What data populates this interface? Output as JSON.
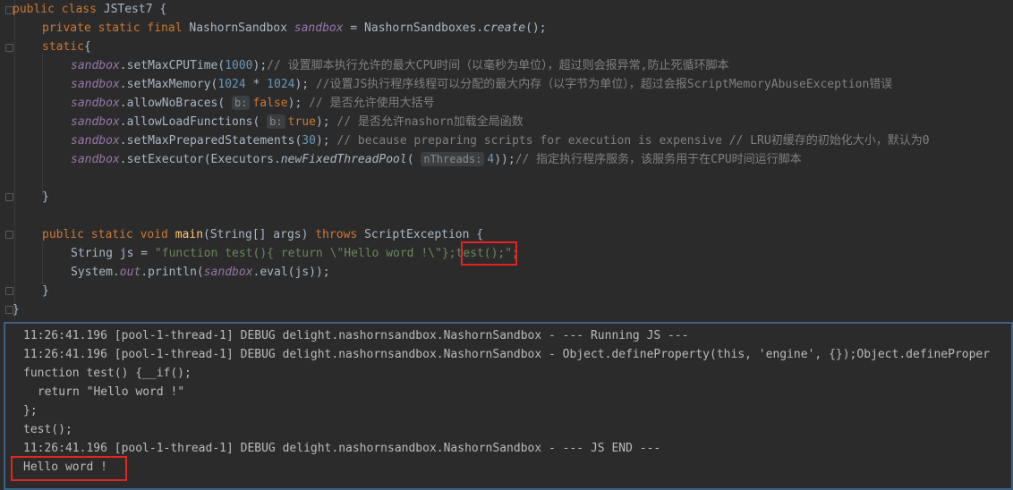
{
  "editor": {
    "lines": [
      [
        {
          "t": "public class ",
          "c": "kw"
        },
        {
          "t": "JSTest7 {",
          "c": ""
        }
      ],
      [
        {
          "t": "private static final ",
          "c": "kw"
        },
        {
          "t": "NashornSandbox ",
          "c": ""
        },
        {
          "t": "sandbox",
          "c": "fld"
        },
        {
          "t": " = NashornSandboxes.",
          "c": ""
        },
        {
          "t": "create",
          "c": "st"
        },
        {
          "t": "();",
          "c": ""
        }
      ],
      [
        {
          "t": "static",
          "c": "kw"
        },
        {
          "t": "{",
          "c": ""
        }
      ],
      [
        {
          "t": "sandbox",
          "c": "fld"
        },
        {
          "t": ".setMaxCPUTime(",
          "c": ""
        },
        {
          "t": "1000",
          "c": "num"
        },
        {
          "t": ");",
          "c": ""
        },
        {
          "t": "// 设置脚本执行允许的最大CPU时间（以毫秒为单位），超过则会报异常,防止死循环脚本",
          "c": "cmt"
        }
      ],
      [
        {
          "t": "sandbox",
          "c": "fld"
        },
        {
          "t": ".setMaxMemory(",
          "c": ""
        },
        {
          "t": "1024",
          "c": "num"
        },
        {
          "t": " * ",
          "c": ""
        },
        {
          "t": "1024",
          "c": "num"
        },
        {
          "t": "); ",
          "c": ""
        },
        {
          "t": "//设置JS执行程序线程可以分配的最大内存（以字节为单位），超过会报ScriptMemoryAbuseException错误",
          "c": "cmt"
        }
      ],
      [
        {
          "t": "sandbox",
          "c": "fld"
        },
        {
          "t": ".allowNoBraces( ",
          "c": ""
        },
        {
          "t": "b:",
          "c": "hint"
        },
        {
          "t": "false",
          "c": "kw"
        },
        {
          "t": "); ",
          "c": ""
        },
        {
          "t": "// 是否允许使用大括号",
          "c": "cmt"
        }
      ],
      [
        {
          "t": "sandbox",
          "c": "fld"
        },
        {
          "t": ".allowLoadFunctions( ",
          "c": ""
        },
        {
          "t": "b:",
          "c": "hint"
        },
        {
          "t": "true",
          "c": "kw"
        },
        {
          "t": "); ",
          "c": ""
        },
        {
          "t": "// 是否允许nashorn加载全局函数",
          "c": "cmt"
        }
      ],
      [
        {
          "t": "sandbox",
          "c": "fld"
        },
        {
          "t": ".setMaxPreparedStatements(",
          "c": ""
        },
        {
          "t": "30",
          "c": "num"
        },
        {
          "t": "); ",
          "c": ""
        },
        {
          "t": "// because preparing scripts for execution is expensive // LRU初缓存的初始化大小，默认为0",
          "c": "cmt"
        }
      ],
      [
        {
          "t": "sandbox",
          "c": "fld"
        },
        {
          "t": ".setExecutor(Executors.",
          "c": ""
        },
        {
          "t": "newFixedThreadPool",
          "c": "st"
        },
        {
          "t": "( ",
          "c": ""
        },
        {
          "t": "nThreads:",
          "c": "hint"
        },
        {
          "t": "4",
          "c": "num"
        },
        {
          "t": "));",
          "c": ""
        },
        {
          "t": "// 指定执行程序服务，该服务用于在CPU时间运行脚本",
          "c": "cmt"
        }
      ],
      [],
      [
        {
          "t": "}",
          "c": ""
        }
      ],
      [],
      [
        {
          "t": "public static void ",
          "c": "kw"
        },
        {
          "t": "main",
          "c": "fn"
        },
        {
          "t": "(String[] args) ",
          "c": ""
        },
        {
          "t": "throws ",
          "c": "kw"
        },
        {
          "t": "ScriptException {",
          "c": ""
        }
      ],
      [
        {
          "t": "String js = ",
          "c": ""
        },
        {
          "t": "\"function test(){ return \\\"Hello word !\\\"};test();\"",
          "c": "str"
        },
        {
          "t": ";",
          "c": "kw"
        }
      ],
      [
        {
          "t": "System.",
          "c": ""
        },
        {
          "t": "out",
          "c": "fld"
        },
        {
          "t": ".println(",
          "c": ""
        },
        {
          "t": "sandbox",
          "c": "fld"
        },
        {
          "t": ".eval(js));",
          "c": ""
        }
      ],
      [
        {
          "t": "}",
          "c": ""
        }
      ],
      [
        {
          "t": "}",
          "c": ""
        }
      ]
    ]
  },
  "console": {
    "lines": [
      "11:26:41.196 [pool-1-thread-1] DEBUG delight.nashornsandbox.NashornSandbox - --- Running JS ---",
      "11:26:41.196 [pool-1-thread-1] DEBUG delight.nashornsandbox.NashornSandbox - Object.defineProperty(this, 'engine', {});Object.defineProper",
      "function test() {__if();",
      " return \"Hello word !\"",
      "};",
      "test();",
      "11:26:41.196 [pool-1-thread-1] DEBUG delight.nashornsandbox.NashornSandbox - --- JS END ---",
      "Hello word !"
    ]
  }
}
